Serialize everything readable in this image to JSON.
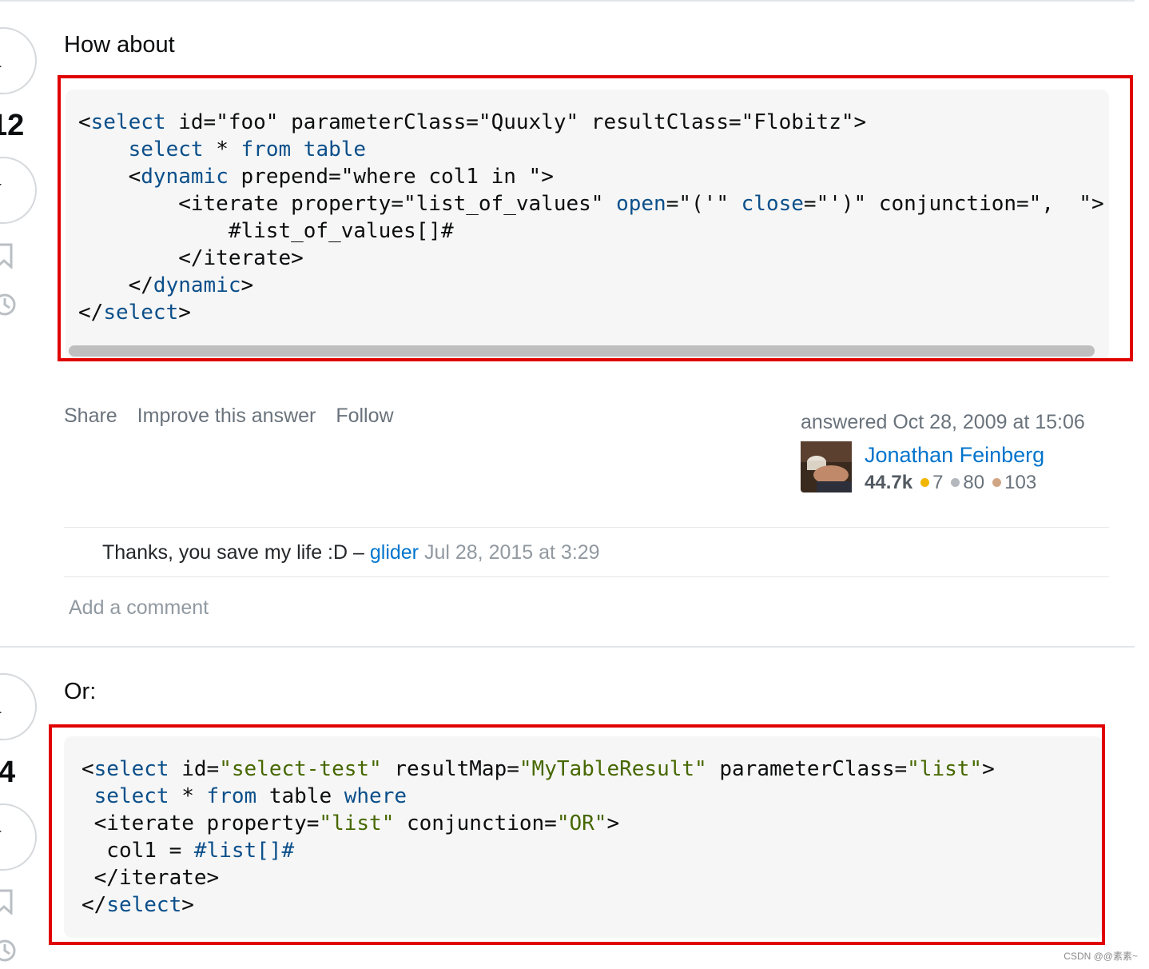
{
  "answer1": {
    "score": "12",
    "intro": "How about",
    "code": [
      [
        [
          "t",
          "<"
        ],
        [
          "k",
          "select"
        ],
        [
          "t",
          " id=\"foo\" parameterClass=\"Quuxly\" resultClass=\"Flobitz\">"
        ]
      ],
      [
        [
          "t",
          "    "
        ],
        [
          "k",
          "select"
        ],
        [
          "t",
          " * "
        ],
        [
          "k",
          "from"
        ],
        [
          "t",
          " "
        ],
        [
          "k",
          "table"
        ]
      ],
      [
        [
          "t",
          "    <"
        ],
        [
          "k",
          "dynamic"
        ],
        [
          "t",
          " prepend=\"where col1 in \">"
        ]
      ],
      [
        [
          "t",
          "        <iterate property=\"list_of_values\" "
        ],
        [
          "k",
          "open"
        ],
        [
          "t",
          "=\"('\" "
        ],
        [
          "k",
          "close"
        ],
        [
          "t",
          "=\"')\" conjunction=\",  \">"
        ]
      ],
      [
        [
          "t",
          "            #list_of_values[]#"
        ]
      ],
      [
        [
          "t",
          "        </iterate>"
        ]
      ],
      [
        [
          "t",
          "    </"
        ],
        [
          "k",
          "dynamic"
        ],
        [
          "t",
          ">"
        ]
      ],
      [
        [
          "t",
          "</"
        ],
        [
          "k",
          "select"
        ],
        [
          "t",
          ">"
        ]
      ]
    ],
    "menu": {
      "share": "Share",
      "improve": "Improve this answer",
      "follow": "Follow"
    },
    "answered": "answered Oct 28, 2009 at 15:06",
    "user": {
      "name": "Jonathan Feinberg",
      "rep": "44.7k",
      "gold": "7",
      "silver": "80",
      "bronze": "103"
    },
    "comment": {
      "text": "Thanks, you save my life :D – ",
      "user": "glider",
      "date": "Jul 28, 2015 at 3:29"
    },
    "add_comment": "Add a comment"
  },
  "answer2": {
    "score": "4",
    "intro": "Or:",
    "code": [
      [
        [
          "t",
          "<"
        ],
        [
          "k",
          "select"
        ],
        [
          "t",
          " id="
        ],
        [
          "s",
          "\"select-test\""
        ],
        [
          "t",
          " resultMap="
        ],
        [
          "s",
          "\"MyTableResult\""
        ],
        [
          "t",
          " parameterClass="
        ],
        [
          "s",
          "\"list\""
        ],
        [
          "t",
          ">"
        ]
      ],
      [
        [
          "t",
          " "
        ],
        [
          "k",
          "select"
        ],
        [
          "t",
          " * "
        ],
        [
          "k",
          "from"
        ],
        [
          "t",
          " table "
        ],
        [
          "k",
          "where"
        ]
      ],
      [
        [
          "t",
          " <iterate property="
        ],
        [
          "s",
          "\"list\""
        ],
        [
          "t",
          " conjunction="
        ],
        [
          "s",
          "\"OR\""
        ],
        [
          "t",
          ">"
        ]
      ],
      [
        [
          "t",
          "  col1 = "
        ],
        [
          "k",
          "#list[]#"
        ]
      ],
      [
        [
          "t",
          " </iterate>"
        ]
      ],
      [
        [
          "t",
          "</"
        ],
        [
          "k",
          "select"
        ],
        [
          "t",
          ">"
        ]
      ]
    ]
  },
  "watermark": "CSDN @@素素~",
  "colors": {
    "highlight_box": "#e00000",
    "link": "#0074cc",
    "keyword": "#0b4f8a",
    "string": "#476800"
  },
  "icons": [
    "vote-up-icon",
    "vote-down-icon",
    "bookmark-icon",
    "history-icon"
  ]
}
